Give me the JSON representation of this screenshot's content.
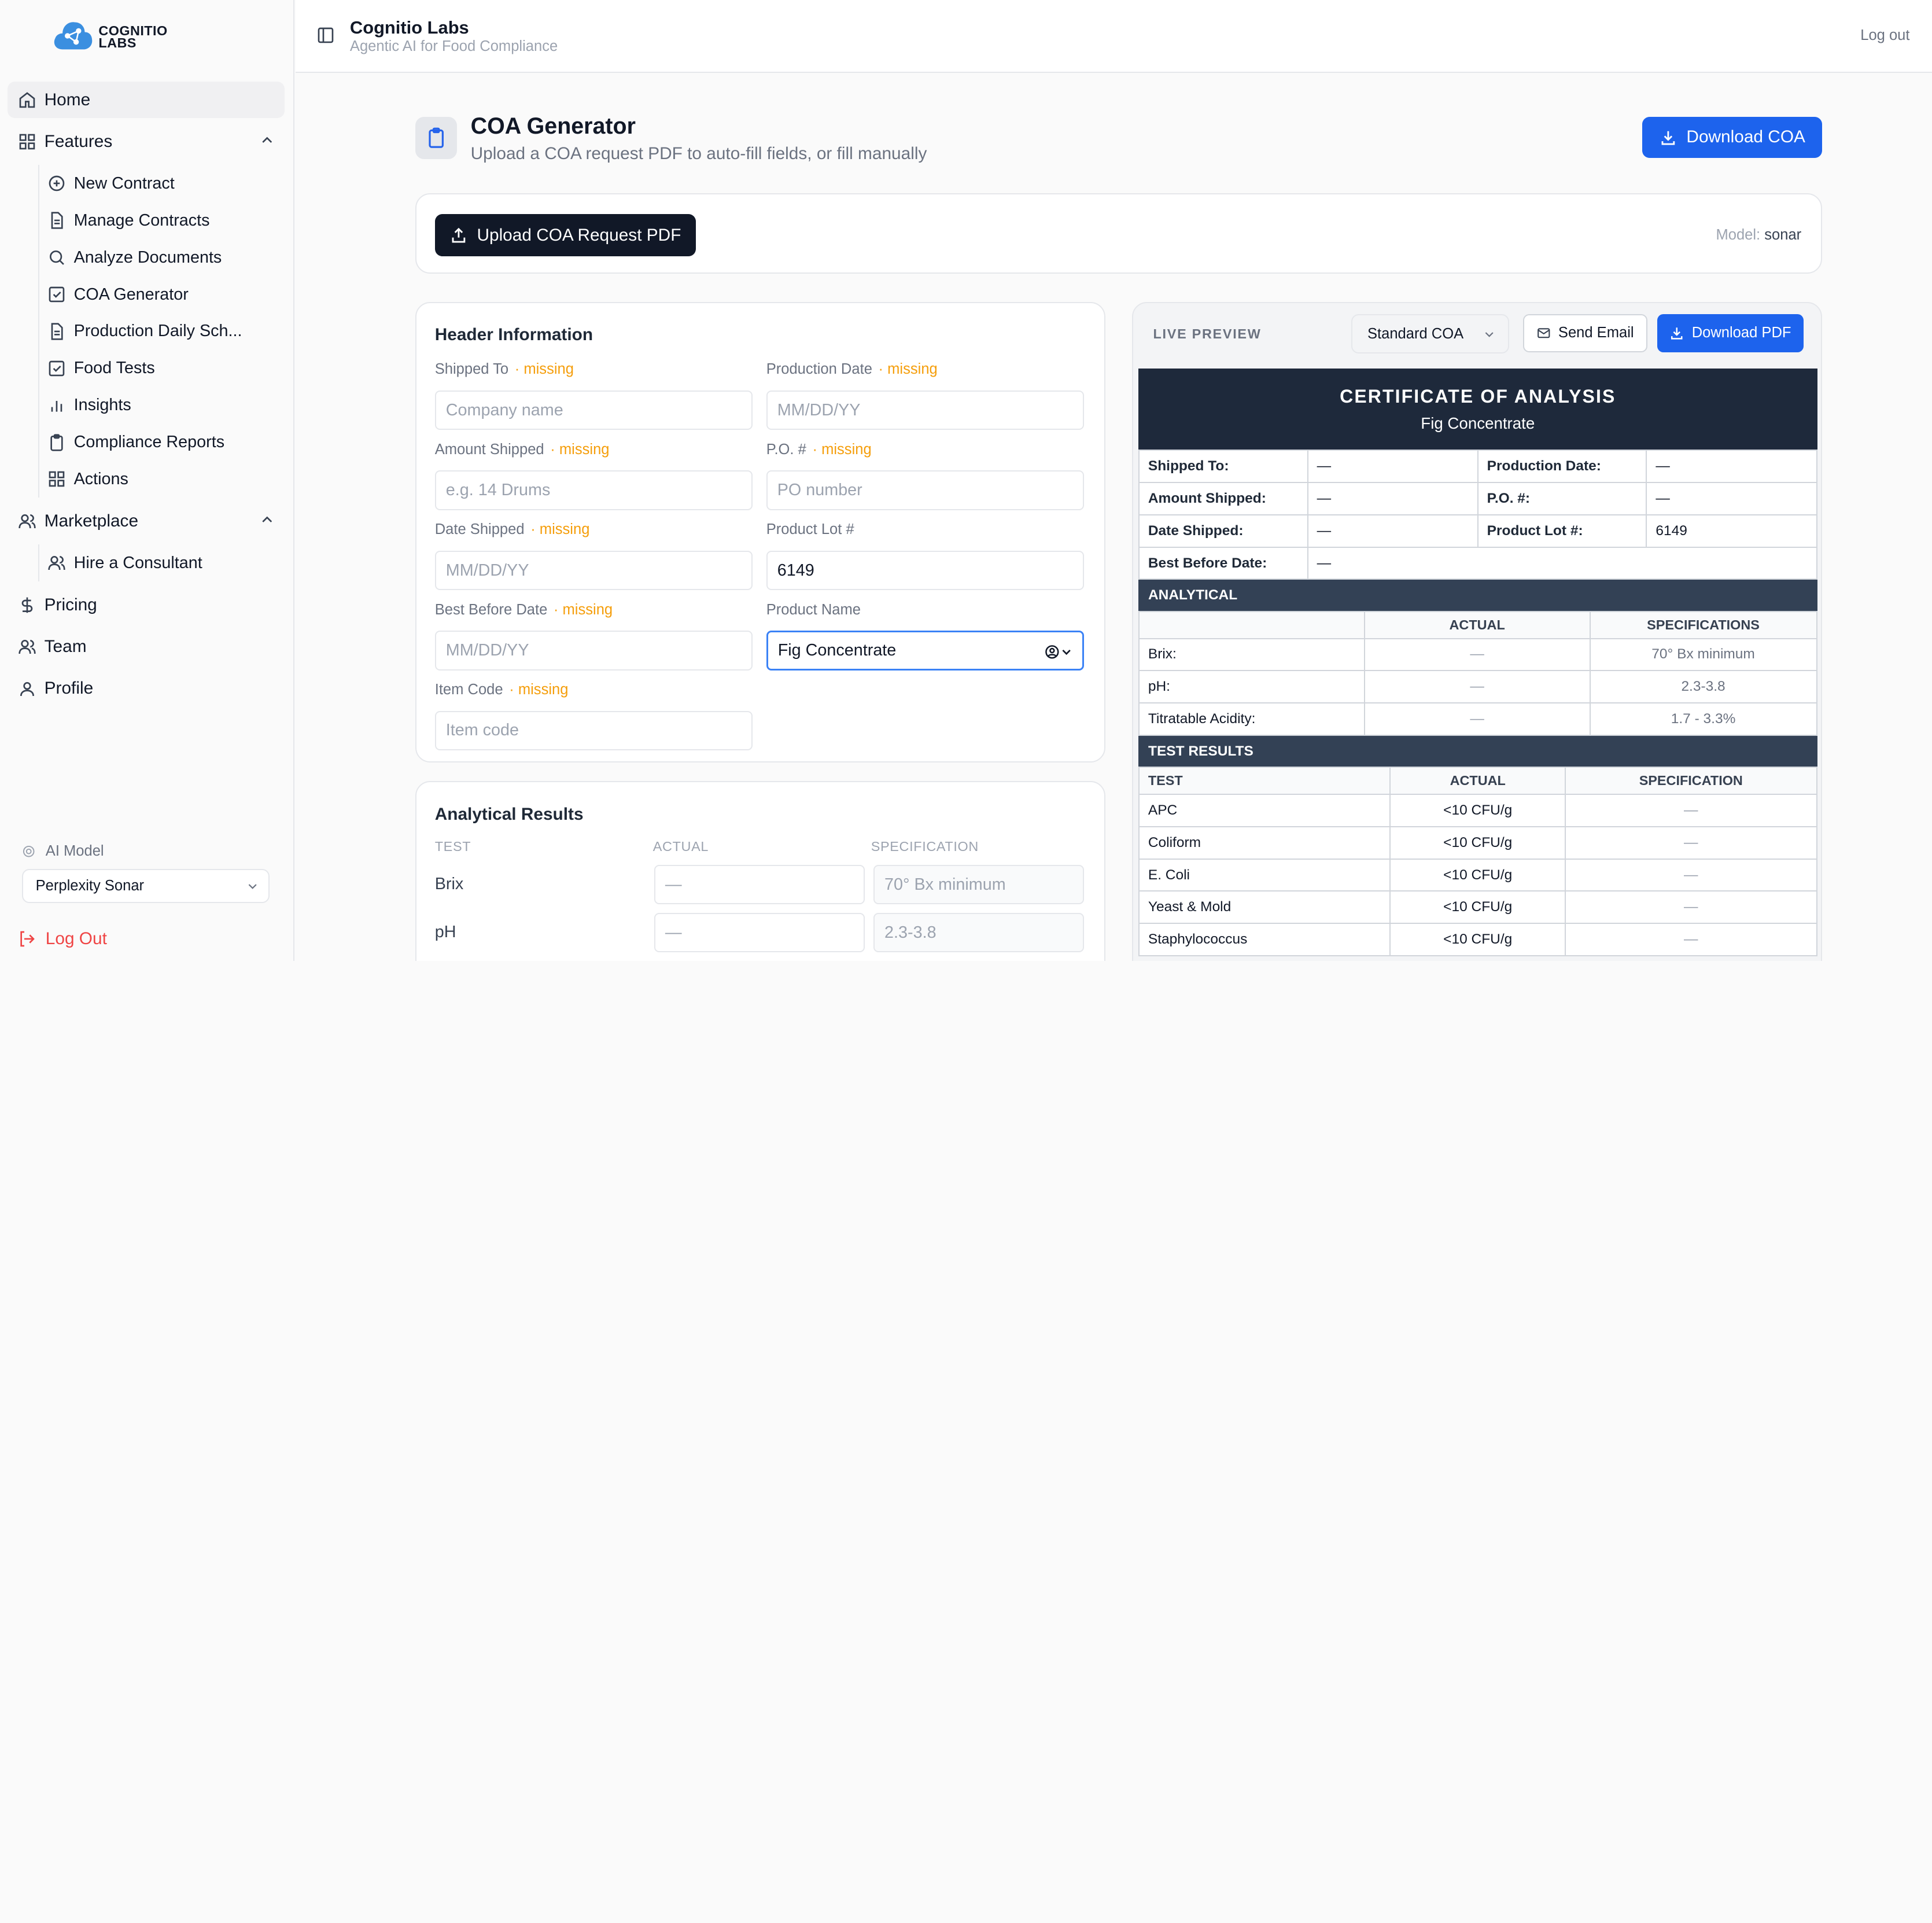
{
  "logo": {
    "line1": "COGNITIO",
    "line2": "LABS"
  },
  "topbar": {
    "title": "Cognitio Labs",
    "subtitle": "Agentic AI for Food Compliance",
    "logout": "Log out"
  },
  "nav": {
    "home": "Home",
    "features": "Features",
    "new_contract": "New Contract",
    "manage_contracts": "Manage Contracts",
    "analyze_documents": "Analyze Documents",
    "coa_generator": "COA Generator",
    "production_daily": "Production Daily Sch...",
    "food_tests": "Food Tests",
    "insights": "Insights",
    "compliance_reports": "Compliance Reports",
    "actions": "Actions",
    "marketplace": "Marketplace",
    "hire_consultant": "Hire a Consultant",
    "pricing": "Pricing",
    "team": "Team",
    "profile": "Profile"
  },
  "ai_model": {
    "label": "AI Model",
    "value": "Perplexity Sonar"
  },
  "sidebar_logout": "Log Out",
  "page": {
    "title": "COA Generator",
    "subtitle": "Upload a COA request PDF to auto-fill fields, or fill manually",
    "download": "Download COA"
  },
  "upload": {
    "button": "Upload COA Request PDF",
    "model_label": "Model:",
    "model_value": "sonar"
  },
  "header_info": {
    "title": "Header Information",
    "missing": "· missing",
    "shipped_to": {
      "label": "Shipped To",
      "placeholder": "Company name"
    },
    "production_date": {
      "label": "Production Date",
      "placeholder": "MM/DD/YY"
    },
    "amount_shipped": {
      "label": "Amount Shipped",
      "placeholder": "e.g. 14 Drums"
    },
    "po": {
      "label": "P.O. #",
      "placeholder": "PO number"
    },
    "date_shipped": {
      "label": "Date Shipped",
      "placeholder": "MM/DD/YY"
    },
    "product_lot": {
      "label": "Product Lot #",
      "value": "6149"
    },
    "best_before": {
      "label": "Best Before Date",
      "placeholder": "MM/DD/YY"
    },
    "product_name": {
      "label": "Product Name",
      "value": "Fig Concentrate"
    },
    "item_code": {
      "label": "Item Code",
      "placeholder": "Item code"
    }
  },
  "analytical_results": {
    "title": "Analytical Results",
    "col_test": "TEST",
    "col_actual": "ACTUAL",
    "col_spec": "SPECIFICATION",
    "rows": [
      {
        "test": "Brix",
        "actual": "—",
        "spec": "70° Bx minimum"
      },
      {
        "test": "pH",
        "actual": "—",
        "spec": "2.3-3.8"
      }
    ]
  },
  "preview": {
    "label": "LIVE PREVIEW",
    "template": "Standard COA",
    "send_email": "Send Email",
    "download_pdf": "Download PDF",
    "cert_title": "CERTIFICATE OF ANALYSIS",
    "cert_product": "Fig Concentrate",
    "dash": "—",
    "info": {
      "shipped_to": "Shipped To:",
      "production_date": "Production Date:",
      "amount_shipped": "Amount Shipped:",
      "po": "P.O. #:",
      "date_shipped": "Date Shipped:",
      "product_lot": "Product Lot #:",
      "product_lot_value": "6149",
      "best_before": "Best Before Date:"
    },
    "analytical": {
      "title": "ANALYTICAL",
      "col_actual": "ACTUAL",
      "col_spec": "SPECIFICATIONS",
      "rows": [
        {
          "name": "Brix:",
          "actual": "—",
          "spec": "70° Bx minimum"
        },
        {
          "name": "pH:",
          "actual": "—",
          "spec": "2.3-3.8"
        },
        {
          "name": "Titratable Acidity:",
          "actual": "—",
          "spec": "1.7 - 3.3%"
        }
      ]
    },
    "test_results": {
      "title": "TEST RESULTS",
      "col_test": "TEST",
      "col_actual": "ACTUAL",
      "col_spec": "SPECIFICATION",
      "rows": [
        {
          "test": "APC",
          "actual": "<10 CFU/g",
          "spec": "—"
        },
        {
          "test": "Coliform",
          "actual": "<10 CFU/g",
          "spec": "—"
        },
        {
          "test": "E. Coli",
          "actual": "<10 CFU/g",
          "spec": "—"
        },
        {
          "test": "Yeast & Mold",
          "actual": "<10 CFU/g",
          "spec": "—"
        },
        {
          "test": "Staphylococcus",
          "actual": "<10 CFU/g",
          "spec": "—"
        }
      ]
    }
  },
  "colors": {
    "accent": "#1d63ed",
    "dark": "#111827",
    "missing": "#f59e0b",
    "coa_header": "#1e293b",
    "section": "#334155",
    "logout": "#ef4444"
  }
}
